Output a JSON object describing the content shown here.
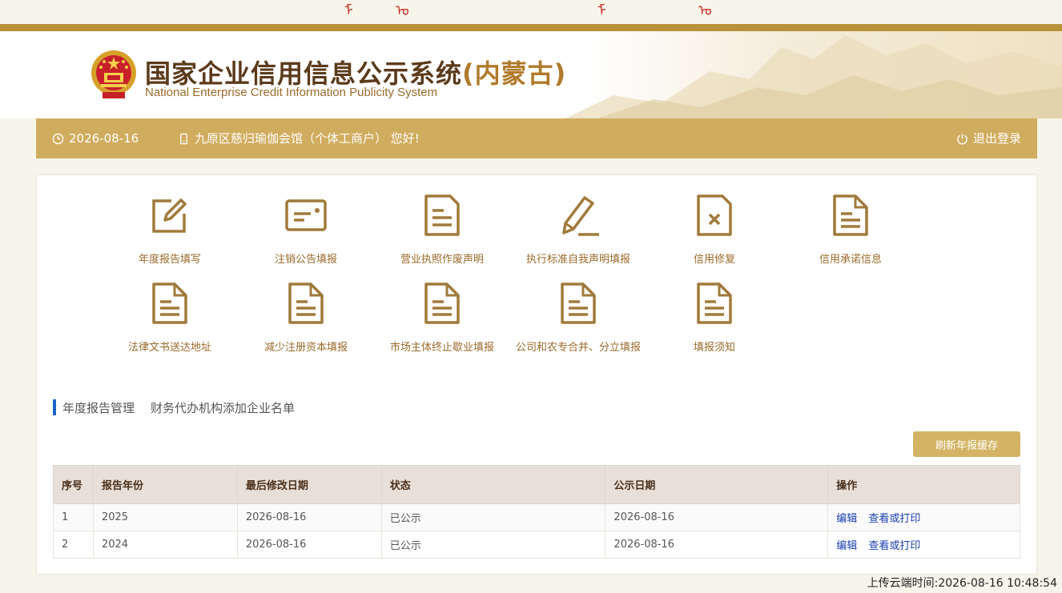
{
  "header": {
    "title_cn": "国家企业信用信息公示系统",
    "title_region": "(内蒙古)",
    "title_en": "National Enterprise Credit Information Publicity System"
  },
  "navbar": {
    "date": "2026-08-16",
    "user": "九原区慈归瑜伽会馆（个体工商户） 您好!",
    "logout": "退出登录"
  },
  "services": [
    {
      "label": "年度报告填写",
      "icon": "edit-icon"
    },
    {
      "label": "注销公告填报",
      "icon": "id-card-icon"
    },
    {
      "label": "营业执照作废声明",
      "icon": "document-icon"
    },
    {
      "label": "执行标准自我声明填报",
      "icon": "pencil-icon"
    },
    {
      "label": "信用修复",
      "icon": "document-x-icon"
    },
    {
      "label": "信用承诺信息",
      "icon": "document-icon"
    },
    {
      "label": "法律文书送达地址",
      "icon": "document-icon"
    },
    {
      "label": "减少注册资本填报",
      "icon": "document-icon"
    },
    {
      "label": "市场主体终止歇业填报",
      "icon": "document-icon"
    },
    {
      "label": "公司和农专合并、分立填报",
      "icon": "document-icon"
    },
    {
      "label": "填报须知",
      "icon": "document-icon"
    }
  ],
  "section": {
    "tabs": [
      "年度报告管理",
      "财务代办机构添加企业名单"
    ]
  },
  "refresh_button": "刷新年报缓存",
  "table": {
    "headers": [
      "序号",
      "报告年份",
      "最后修改日期",
      "状态",
      "公示日期",
      "操作"
    ],
    "rows": [
      {
        "no": "1",
        "year": "2025",
        "modified": "2026-08-16",
        "status": "已公示",
        "publish": "2026-08-16",
        "edit": "编辑",
        "view": "查看或打印"
      },
      {
        "no": "2",
        "year": "2024",
        "modified": "2026-08-16",
        "status": "已公示",
        "publish": "2026-08-16",
        "edit": "编辑",
        "view": "查看或打印"
      }
    ]
  },
  "footer": {
    "upload_time": "上传云端时间:2026-08-16 10:48:54"
  },
  "colors": {
    "gold": "#d0ac5e",
    "icon_brown": "#a07a3a",
    "link_blue": "#1a3fb0",
    "accent_blue": "#1e64c8"
  }
}
